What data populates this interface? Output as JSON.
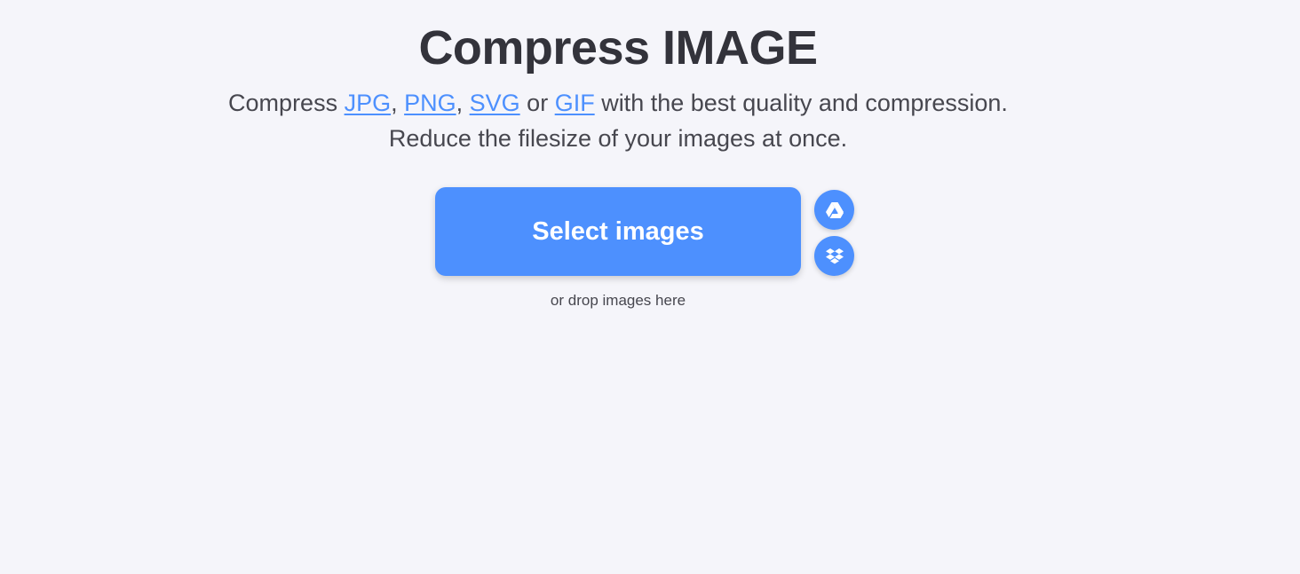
{
  "header": {
    "title": "Compress IMAGE"
  },
  "intro": {
    "prefix": "Compress ",
    "formats": [
      "JPG",
      "PNG",
      "SVG",
      "GIF"
    ],
    "sep1": ", ",
    "sep2": ", ",
    "sep3": " or ",
    "suffix": " with the best quality and compression.",
    "line2": "Reduce the filesize of your images at once."
  },
  "upload": {
    "select_label": "Select images",
    "drop_hint": "or drop images here"
  },
  "cloud_buttons": [
    {
      "icon": "google-drive-icon"
    },
    {
      "icon": "dropbox-icon"
    }
  ],
  "colors": {
    "accent": "#4d90fe",
    "background": "#f5f5fa",
    "title": "#33333b",
    "text": "#47474f"
  }
}
